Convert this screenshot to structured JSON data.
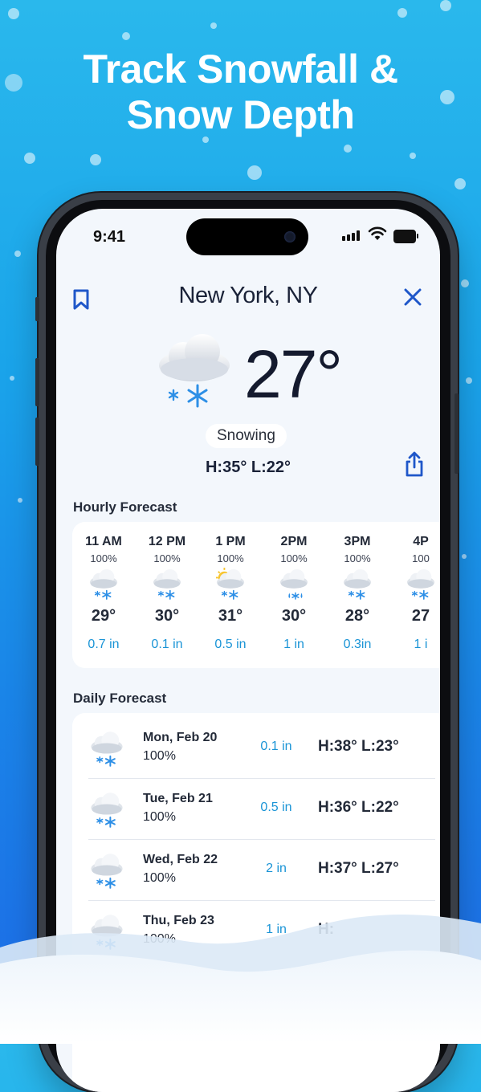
{
  "promo": {
    "headline_line1": "Track Snowfall &",
    "headline_line2": "Snow Depth"
  },
  "status_bar": {
    "time": "9:41"
  },
  "header": {
    "city": "New York, NY",
    "bookmark_icon": "bookmark-icon",
    "close_icon": "close-icon"
  },
  "current": {
    "temperature": "27°",
    "condition": "Snowing",
    "high_low": "H:35°  L:22°",
    "icon": "snow-cloud-icon"
  },
  "hourly": {
    "title": "Hourly Forecast",
    "items": [
      {
        "time": "11 AM",
        "precip": "100%",
        "icon": "snow-cloud-icon",
        "temp": "29°",
        "amount": "0.7 in"
      },
      {
        "time": "12 PM",
        "precip": "100%",
        "icon": "snow-cloud-icon",
        "temp": "30°",
        "amount": "0.1 in"
      },
      {
        "time": "1 PM",
        "precip": "100%",
        "icon": "sun-snow-cloud-icon",
        "temp": "31°",
        "amount": "0.5 in"
      },
      {
        "time": "2PM",
        "precip": "100%",
        "icon": "sleet-cloud-icon",
        "temp": "30°",
        "amount": "1 in"
      },
      {
        "time": "3PM",
        "precip": "100%",
        "icon": "snow-cloud-icon",
        "temp": "28°",
        "amount": "0.3in"
      },
      {
        "time": "4P",
        "precip": "100",
        "icon": "snow-cloud-icon",
        "temp": "27",
        "amount": "1 i"
      }
    ]
  },
  "daily": {
    "title": "Daily Forecast",
    "items": [
      {
        "day": "Mon, Feb 20",
        "precip": "100%",
        "amount": "0.1 in",
        "high_low": "H:38° L:23°",
        "icon": "snow-cloud-icon"
      },
      {
        "day": "Tue, Feb 21",
        "precip": "100%",
        "amount": "0.5 in",
        "high_low": "H:36° L:22°",
        "icon": "snow-cloud-icon"
      },
      {
        "day": "Wed, Feb 22",
        "precip": "100%",
        "amount": "2 in",
        "high_low": "H:37° L:27°",
        "icon": "snow-cloud-icon"
      },
      {
        "day": "Thu, Feb 23",
        "precip": "100%",
        "amount": "1 in",
        "high_low": "H:",
        "icon": "snow-cloud-icon"
      }
    ]
  },
  "colors": {
    "accent": "#1f57c9",
    "snow_amount": "#1a94d6",
    "background_top": "#2ab8ec",
    "background_bottom": "#1d6ae6"
  }
}
